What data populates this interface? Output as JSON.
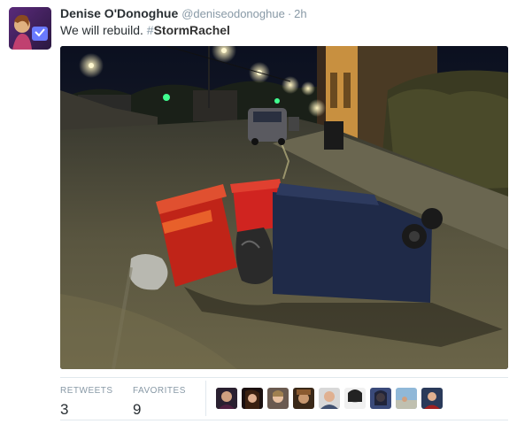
{
  "tweet": {
    "author_name": "Denise O'Donoghue",
    "handle": "@deniseodonoghue",
    "separator": "·",
    "time": "2h",
    "text_before": "We will rebuild. ",
    "hashtag_symbol": "#",
    "hashtag": "StormRachel"
  },
  "stats": {
    "retweets_label": "RETWEETS",
    "retweets_count": "3",
    "favorites_label": "FAVORITES",
    "favorites_count": "9"
  },
  "icons": {
    "avatar": "profile-photo",
    "photo": "street-night-bins-photo",
    "favoriters": [
      "avatar-1",
      "avatar-2",
      "avatar-3",
      "avatar-4",
      "avatar-5",
      "avatar-6",
      "avatar-7",
      "avatar-8",
      "avatar-9"
    ]
  },
  "colors": {
    "text": "#292f33",
    "muted": "#8899a6",
    "border": "#e1e8ed"
  }
}
